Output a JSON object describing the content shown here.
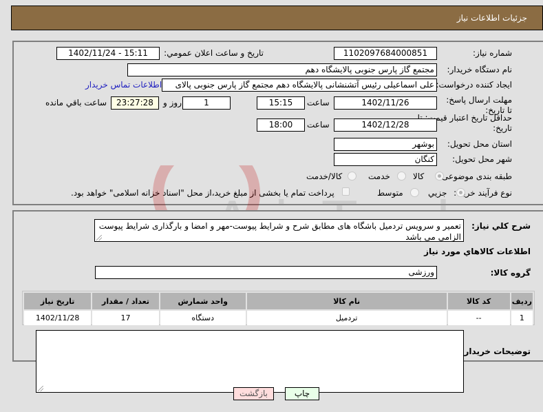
{
  "header": {
    "title": "جزئيات اطلاعات نياز"
  },
  "form": {
    "need_number": {
      "label": "شماره نياز:",
      "value": "1102097684000851"
    },
    "announce_datetime": {
      "label": "تاريخ و ساعت اعلان عمومي:",
      "value": "1402/11/24 - 15:11"
    },
    "buyer_org": {
      "label": "نام دستگاه خريدار:",
      "value": "مجتمع گاز پارس جنوبی  پالایشگاه دهم"
    },
    "requester": {
      "label": "ايجاد کننده درخواست:",
      "value": "علی اسماعیلی رئیس آتشنشانی پالایشگاه دهم  مجتمع گاز پارس جنوبی  پالای"
    },
    "buyer_contact_link": "اطلاعات تماس خريدار",
    "reply_deadline": {
      "label": "مهلت ارسال پاسخ: تا تاريخ:",
      "date": "1402/11/26",
      "time_label": "ساعت",
      "time": "15:15",
      "days": "1",
      "days_label": "روز و",
      "remaining": "23:27:28",
      "remaining_label": "ساعت باقي مانده"
    },
    "price_validity": {
      "label": "حداقل تاريخ اعتبار قيمت: تا تاريخ:",
      "date": "1402/12/28",
      "time_label": "ساعت",
      "time": "18:00"
    },
    "delivery_province": {
      "label": "استان محل تحويل:",
      "value": "بوشهر"
    },
    "delivery_city": {
      "label": "شهر محل تحويل:",
      "value": "کنگان"
    },
    "category": {
      "label": "طبقه بندی موضوعی:",
      "options": [
        "کالا",
        "خدمت",
        "کالا/خدمت"
      ],
      "selected": "کالا"
    },
    "purchase_type": {
      "label": "نوع فرآيند خريد :",
      "options": [
        "جزيي",
        "متوسط"
      ],
      "selected": "جزيي",
      "treasury_checkbox_label": "پرداخت تمام يا بخشی از مبلغ خريد،از محل \"اسناد خزانه اسلامی\" خواهد بود.",
      "treasury_checked": false
    }
  },
  "description": {
    "label": "شرح كلي نياز:",
    "value": "تعمیر و سرویس تردمیل باشگاه های مطابق شرح و شرایط پیوست-مهر و امضا و بارگذاری شرایط پیوست الزامی می باشد"
  },
  "goods_section": {
    "title": "اطلاعات كالاهاي مورد نياز",
    "group_label": "گروه كالا:",
    "group_value": "ورزشی",
    "table": {
      "headers": [
        "رديف",
        "كد كالا",
        "نام كالا",
        "واحد شمارش",
        "تعداد / مقدار",
        "تاريخ نياز"
      ],
      "rows": [
        [
          "1",
          "--",
          "تردمیل",
          "دستگاه",
          "17",
          "1402/11/28"
        ]
      ]
    }
  },
  "buyer_notes": {
    "label": "توضيحات خريدار:",
    "value": ""
  },
  "buttons": {
    "print": "چاپ",
    "back": "بازگشت"
  },
  "watermark": {
    "text": "AriaTender.net"
  },
  "colors": {
    "header_bg": "#8b6c43",
    "page_bg": "#e1e1e1",
    "link": "#2020c0",
    "remaining_bg": "#ffffe5",
    "back_bg": "#ffdddd",
    "print_bg": "#e8ffe8"
  }
}
